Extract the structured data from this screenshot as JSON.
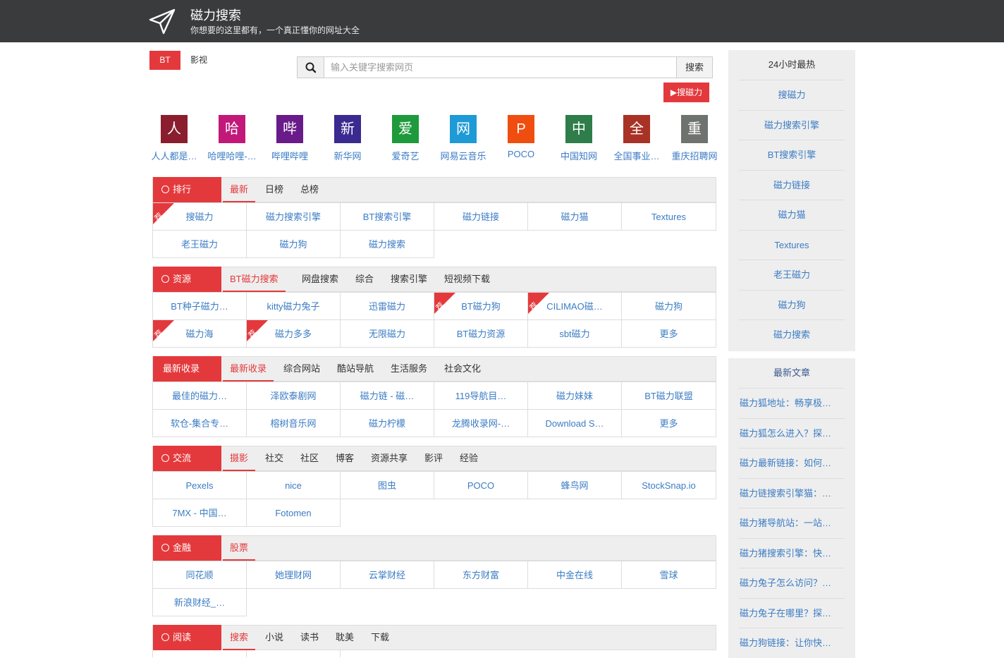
{
  "header": {
    "title": "磁力搜索",
    "slogan": "你想要的这里都有，一个真正懂你的网址大全"
  },
  "category_tabs": [
    "BT",
    "影视"
  ],
  "search": {
    "placeholder": "输入关键字搜索网页",
    "button": "搜索"
  },
  "promo_button": "▶搜磁力",
  "quick_links": [
    {
      "char": "人",
      "label": "人人都是…",
      "color": "#8b1e2e"
    },
    {
      "char": "哈",
      "label": "哈哩哈哩-…",
      "color": "#c2187a"
    },
    {
      "char": "哔",
      "label": "哔哩哔哩",
      "color": "#6a1b8a"
    },
    {
      "char": "新",
      "label": "新华网",
      "color": "#3b2a8f"
    },
    {
      "char": "爱",
      "label": "爱奇艺",
      "color": "#1e9a3c"
    },
    {
      "char": "网",
      "label": "网易云音乐",
      "color": "#1e9ad6"
    },
    {
      "char": "P",
      "label": "POCO",
      "color": "#f04e10"
    },
    {
      "char": "中",
      "label": "中国知网",
      "color": "#2e7d4a"
    },
    {
      "char": "全",
      "label": "全国事业…",
      "color": "#a83225"
    },
    {
      "char": "重",
      "label": "重庆招聘网",
      "color": "#6f7370"
    }
  ],
  "panels": [
    {
      "label": "排行",
      "icon": "clock-icon",
      "tabs": [
        "最新",
        "日榜",
        "总榜"
      ],
      "cells": [
        {
          "text": "搜磁力",
          "rec": true
        },
        {
          "text": "磁力搜索引擎"
        },
        {
          "text": "BT搜索引擎"
        },
        {
          "text": "磁力链接"
        },
        {
          "text": "磁力猫"
        },
        {
          "text": "Textures"
        },
        {
          "text": "老王磁力"
        },
        {
          "text": "磁力狗"
        },
        {
          "text": "磁力搜索"
        }
      ]
    },
    {
      "label": "资源",
      "icon": "download-icon",
      "tabs": [
        "BT磁力搜索",
        "网盘搜索",
        "综合",
        "搜索引擎",
        "短视频下载"
      ],
      "cells": [
        {
          "text": "BT种子磁力…"
        },
        {
          "text": "kitty磁力兔子"
        },
        {
          "text": "迅雷磁力"
        },
        {
          "text": "BT磁力狗",
          "rec": true
        },
        {
          "text": "CILIMAO磁…",
          "rec": true
        },
        {
          "text": "磁力狗"
        },
        {
          "text": "磁力海",
          "rec": true
        },
        {
          "text": "磁力多多",
          "rec": true
        },
        {
          "text": "无限磁力"
        },
        {
          "text": "BT磁力资源"
        },
        {
          "text": "sbt磁力"
        },
        {
          "text": "更多"
        }
      ]
    },
    {
      "label": "最新收录",
      "icon": "",
      "tabs": [
        "最新收录",
        "综合网站",
        "酷站导航",
        "生活服务",
        "社会文化"
      ],
      "cells": [
        {
          "text": "最佳的磁力…"
        },
        {
          "text": "泽欧泰剧网"
        },
        {
          "text": "磁力链 - 磁…"
        },
        {
          "text": "119导航目…"
        },
        {
          "text": "磁力妹妹"
        },
        {
          "text": "BT磁力联盟"
        },
        {
          "text": "软仓-集合专…"
        },
        {
          "text": "榕树音乐网"
        },
        {
          "text": "磁力柠檬"
        },
        {
          "text": "龙腾收录网-…"
        },
        {
          "text": "Download S…"
        },
        {
          "text": "更多"
        }
      ]
    },
    {
      "label": "交流",
      "icon": "clock-icon",
      "tabs": [
        "摄影",
        "社交",
        "社区",
        "博客",
        "资源共享",
        "影评",
        "经验"
      ],
      "cells": [
        {
          "text": "Pexels"
        },
        {
          "text": "nice"
        },
        {
          "text": "图虫"
        },
        {
          "text": "POCO"
        },
        {
          "text": "蜂鸟网"
        },
        {
          "text": "StockSnap.io"
        },
        {
          "text": "7MX - 中国…"
        },
        {
          "text": "Fotomen"
        }
      ]
    },
    {
      "label": "金融",
      "icon": "clock-icon",
      "tabs": [
        "股票"
      ],
      "cells": [
        {
          "text": "同花顺"
        },
        {
          "text": "她理财网"
        },
        {
          "text": "云掌财经"
        },
        {
          "text": "东方财富"
        },
        {
          "text": "中金在线"
        },
        {
          "text": "雪球"
        },
        {
          "text": "新浪财经_…"
        }
      ]
    },
    {
      "label": "阅读",
      "icon": "clock-icon",
      "tabs": [
        "搜索",
        "小说",
        "读书",
        "耽美",
        "下载"
      ],
      "cells": []
    }
  ],
  "sidebar_hot": {
    "title": "24小时最热",
    "items": [
      "搜磁力",
      "磁力搜索引擎",
      "BT搜索引擎",
      "磁力链接",
      "磁力猫",
      "Textures",
      "老王磁力",
      "磁力狗",
      "磁力搜索"
    ]
  },
  "sidebar_articles": {
    "title": "最新文章",
    "items": [
      "磁力狐地址：畅享极…",
      "磁力狐怎么进入？探…",
      "磁力最新链接：如何…",
      "磁力链搜索引擎猫：…",
      "磁力猪导航站：一站…",
      "磁力猪搜索引擎：快…",
      "磁力兔子怎么访问？…",
      "磁力兔子在哪里？探…",
      "磁力狗链接：让你快…"
    ]
  },
  "recommend_badge": "荐",
  "colors": {
    "accent": "#e4393c",
    "link": "#3b7cc4",
    "header_bg": "#3a3b3d"
  }
}
